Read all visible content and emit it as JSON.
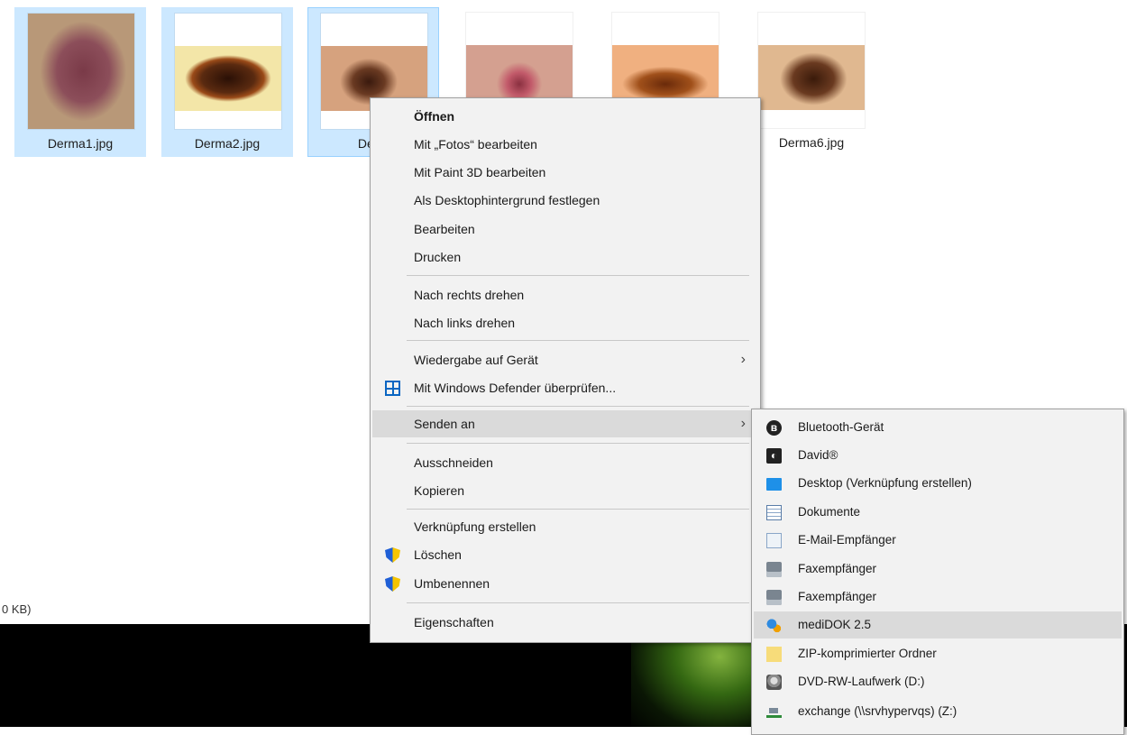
{
  "explorer": {
    "files": [
      {
        "name": "Derma1.jpg",
        "state": "selected",
        "colors": [
          "#b89878",
          "#8a4a55",
          "#6b3a44"
        ]
      },
      {
        "name": "Derma2.jpg",
        "state": "selected",
        "colors": [
          "#f3e6a8",
          "#3a1a0a",
          "#8a3a10"
        ]
      },
      {
        "name": "Derm",
        "state": "focused",
        "colors": [
          "#d6a27e",
          "#5a2a18",
          "#3a1a0e"
        ]
      },
      {
        "name": "",
        "state": "none",
        "colors": [
          "#d4a090",
          "#c25a6a",
          "#8a3040"
        ]
      },
      {
        "name": "",
        "state": "none",
        "colors": [
          "#f0b080",
          "#a0501a",
          "#6a2a0a"
        ]
      },
      {
        "name": "Derma6.jpg",
        "state": "none",
        "colors": [
          "#e0b890",
          "#6a3a20",
          "#3a1a0a"
        ]
      }
    ],
    "status_text": "0 KB)",
    "right_tick": "("
  },
  "context_menu": {
    "items": [
      {
        "label": "Öffnen",
        "bold": true
      },
      {
        "label": "Mit „Fotos“ bearbeiten"
      },
      {
        "label": "Mit Paint 3D bearbeiten"
      },
      {
        "label": "Als Desktophintergrund festlegen"
      },
      {
        "label": "Bearbeiten"
      },
      {
        "label": "Drucken"
      },
      {
        "label": "Nach rechts drehen"
      },
      {
        "label": "Nach links drehen"
      },
      {
        "label": "Wiedergabe auf Gerät",
        "submenu": true
      },
      {
        "label": "Mit Windows Defender überprüfen...",
        "icon": "defender-icon"
      },
      {
        "label": "Senden an",
        "submenu": true,
        "hover": true
      },
      {
        "label": "Ausschneiden"
      },
      {
        "label": "Kopieren"
      },
      {
        "label": "Verknüpfung erstellen"
      },
      {
        "label": "Löschen",
        "icon": "uac-shield-icon"
      },
      {
        "label": "Umbenennen",
        "icon": "uac-shield-icon"
      },
      {
        "label": "Eigenschaften"
      }
    ],
    "arrow_glyph": "›"
  },
  "send_to_menu": {
    "items": [
      {
        "label": "Bluetooth-Gerät",
        "icon": "bluetooth-icon",
        "glyph": "ʙ"
      },
      {
        "label": "David®",
        "icon": "david-icon",
        "glyph": "◐"
      },
      {
        "label": "Desktop (Verknüpfung erstellen)",
        "icon": "desktop-icon"
      },
      {
        "label": "Dokumente",
        "icon": "documents-icon"
      },
      {
        "label": "E-Mail-Empfänger",
        "icon": "mail-icon"
      },
      {
        "label": "Faxempfänger",
        "icon": "fax-icon"
      },
      {
        "label": "Faxempfänger",
        "icon": "fax-icon"
      },
      {
        "label": "mediDOK 2.5",
        "icon": "medidok-icon",
        "hover": true
      },
      {
        "label": "ZIP-komprimierter Ordner",
        "icon": "zip-folder-icon"
      },
      {
        "label": "DVD-RW-Laufwerk (D:)",
        "icon": "dvd-drive-icon"
      },
      {
        "label": "exchange (\\\\srvhypervqs) (Z:)",
        "icon": "network-drive-icon"
      }
    ]
  },
  "colors": {
    "selection": "#cce8ff",
    "menu_bg": "#f2f2f2",
    "menu_hover": "#dadada"
  }
}
